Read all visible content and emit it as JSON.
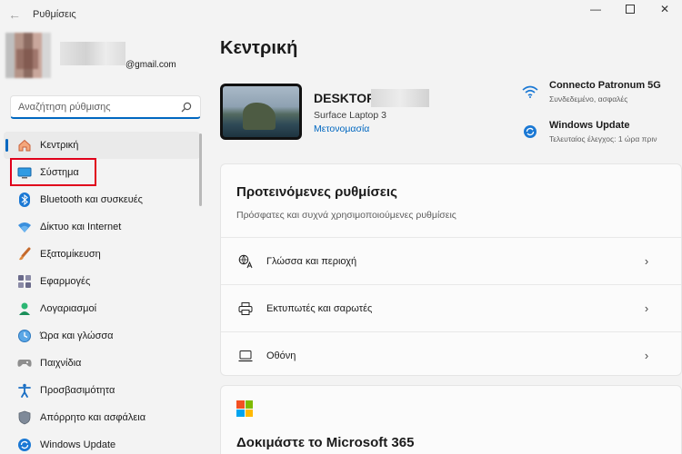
{
  "window": {
    "title": "Ρυθμίσεις",
    "controls": [
      "minimize",
      "maximize",
      "close"
    ]
  },
  "account": {
    "email_suffix": "@gmail.com"
  },
  "search": {
    "placeholder": "Αναζήτηση ρύθμισης"
  },
  "sidebar": {
    "items": [
      {
        "label": "Κεντρική",
        "icon": "home-icon",
        "active": true
      },
      {
        "label": "Σύστημα",
        "icon": "system-icon",
        "highlighted": true
      },
      {
        "label": "Bluetooth και συσκευές",
        "icon": "bluetooth-icon"
      },
      {
        "label": "Δίκτυο και Internet",
        "icon": "network-icon"
      },
      {
        "label": "Εξατομίκευση",
        "icon": "personalization-icon"
      },
      {
        "label": "Εφαρμογές",
        "icon": "apps-icon"
      },
      {
        "label": "Λογαριασμοί",
        "icon": "accounts-icon"
      },
      {
        "label": "Ώρα και γλώσσα",
        "icon": "time-language-icon"
      },
      {
        "label": "Παιχνίδια",
        "icon": "gaming-icon"
      },
      {
        "label": "Προσβασιμότητα",
        "icon": "accessibility-icon"
      },
      {
        "label": "Απόρρητο και ασφάλεια",
        "icon": "privacy-icon"
      },
      {
        "label": "Windows Update",
        "icon": "windows-update-icon"
      }
    ]
  },
  "main": {
    "title": "Κεντρική",
    "device": {
      "name": "DESKTOP",
      "model": "Surface Laptop 3",
      "rename_link": "Μετονομασία"
    },
    "status": [
      {
        "title": "Connecto Patronum 5G",
        "subtitle": "Συνδεδεμένο, ασφαλές",
        "icon": "wifi-icon"
      },
      {
        "title": "Windows Update",
        "subtitle": "Τελευταίος έλεγχος: 1 ώρα πριν",
        "icon": "sync-icon"
      }
    ],
    "recommended": {
      "title": "Προτεινόμενες ρυθμίσεις",
      "subtitle": "Πρόσφατες και συχνά χρησιμοποιούμενες ρυθμίσεις",
      "rows": [
        {
          "label": "Γλώσσα και περιοχή",
          "icon": "language-icon"
        },
        {
          "label": "Εκτυπωτές και σαρωτές",
          "icon": "printer-icon"
        },
        {
          "label": "Οθόνη",
          "icon": "display-icon"
        }
      ]
    },
    "m365": {
      "title": "Δοκιμάστε το Microsoft 365"
    }
  },
  "colors": {
    "accent": "#0067c0",
    "highlight_border": "#e0001b",
    "ms_red": "#f25022",
    "ms_green": "#7fba00",
    "ms_blue": "#00a4ef",
    "ms_yellow": "#ffb900"
  }
}
